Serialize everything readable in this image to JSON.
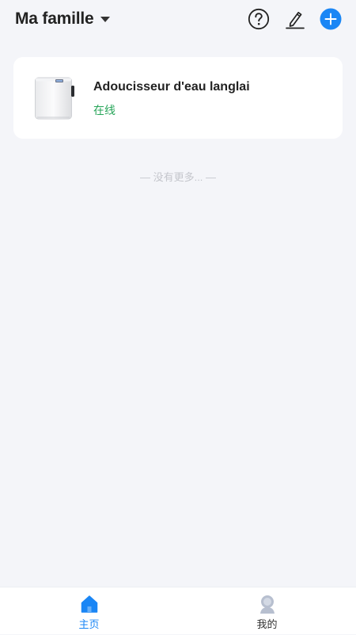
{
  "header": {
    "home_title": "Ma famille",
    "icons": [
      "chevron-down-icon",
      "help-icon",
      "edit-icon",
      "add-icon"
    ]
  },
  "devices": [
    {
      "name": "Adoucisseur d'eau langlai",
      "status": "在线",
      "status_color": "#27a559"
    }
  ],
  "list_end_text": "— 没有更多... —",
  "tabbar": {
    "tabs": [
      {
        "label": "主页",
        "icon": "home-icon",
        "active": true
      },
      {
        "label": "我的",
        "icon": "profile-icon",
        "active": false
      }
    ]
  },
  "colors": {
    "accent": "#1a86f5",
    "background": "#f4f5f9",
    "online": "#27a559"
  }
}
